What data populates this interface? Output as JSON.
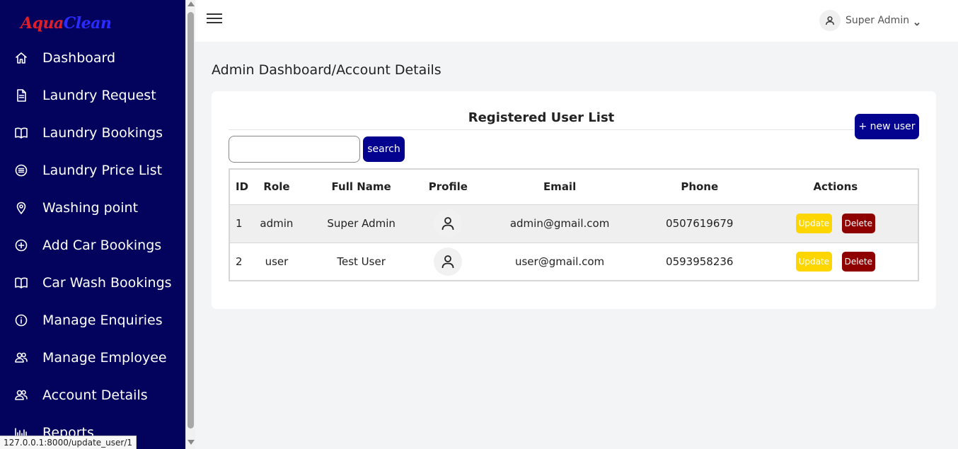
{
  "brand": {
    "part1": "Aqua",
    "part2": "Clean"
  },
  "sidebar": {
    "items": [
      {
        "label": "Dashboard",
        "icon": "home-icon"
      },
      {
        "label": "Laundry Request",
        "icon": "document-icon"
      },
      {
        "label": "Laundry Bookings",
        "icon": "book-icon"
      },
      {
        "label": "Laundry Price List",
        "icon": "list-circle-icon"
      },
      {
        "label": "Washing point",
        "icon": "location-pin-icon"
      },
      {
        "label": "Add Car Bookings",
        "icon": "plus-circle-icon"
      },
      {
        "label": "Car Wash Bookings",
        "icon": "book-icon"
      },
      {
        "label": "Manage Enquiries",
        "icon": "info-circle-icon"
      },
      {
        "label": "Manage Employee",
        "icon": "users-icon"
      },
      {
        "label": "Account Details",
        "icon": "users-icon"
      },
      {
        "label": "Reports",
        "icon": "bar-chart-icon"
      }
    ]
  },
  "header": {
    "user_name": "Super Admin"
  },
  "page": {
    "breadcrumb": "Admin Dashboard/Account Details"
  },
  "card": {
    "title": "Registered User List",
    "new_user_label": "+ new user",
    "search_label": "search",
    "search_value": ""
  },
  "table": {
    "headers": {
      "id": "ID",
      "role": "Role",
      "full_name": "Full Name",
      "profile": "Profile",
      "email": "Email",
      "phone": "Phone",
      "actions": "Actions"
    },
    "rows": [
      {
        "id": "1",
        "role": "admin",
        "full_name": "Super Admin",
        "email": "admin@gmail.com",
        "phone": "0507619679",
        "update": "Update",
        "delete": "Delete"
      },
      {
        "id": "2",
        "role": "user",
        "full_name": "Test User",
        "email": "user@gmail.com",
        "phone": "0593958236",
        "update": "Update",
        "delete": "Delete"
      }
    ]
  },
  "status_bar": {
    "url": "127.0.0.1:8000/update_user/1"
  },
  "colors": {
    "sidebar_bg": "#03035e",
    "primary_button": "#03038f",
    "update_button": "#fdd600",
    "delete_button": "#8f0000",
    "brand_red": "#e11d2a",
    "brand_blue": "#2b2bff"
  }
}
